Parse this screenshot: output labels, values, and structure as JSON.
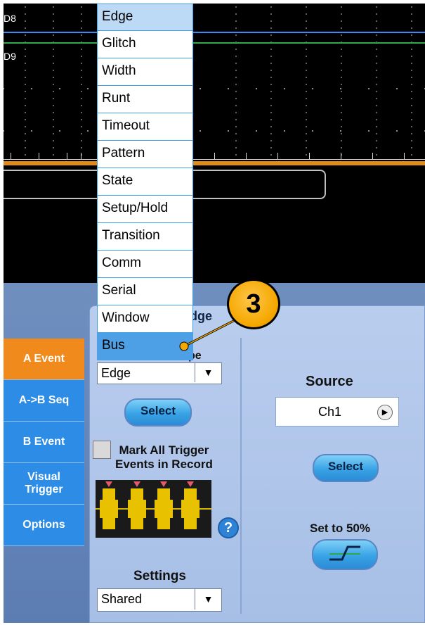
{
  "scope": {
    "channels": [
      "D8",
      "D9"
    ],
    "colors": {
      "d8_line": "#3a8cf0",
      "d9_line": "#2ea84a",
      "orange_line": "#e08a1a"
    }
  },
  "trigger_menu": {
    "items": [
      "Edge",
      "Glitch",
      "Width",
      "Runt",
      "Timeout",
      "Pattern",
      "State",
      "Setup/Hold",
      "Transition",
      "Comm",
      "Serial",
      "Window",
      "Bus"
    ],
    "selected": "Edge",
    "highlighted": "Bus"
  },
  "tabs": [
    "A Event",
    "A->B Seq",
    "B Event",
    "Visual\nTrigger",
    "Options"
  ],
  "panel": {
    "title_fragment": "dge",
    "type_fragment": "pe",
    "type_value": "Edge",
    "type_select_label": "Select",
    "mark_all_label": "Mark All Trigger\nEvents in Record",
    "help_icon": "question-mark",
    "settings_label": "Settings",
    "settings_value": "Shared",
    "source_label": "Source",
    "source_value": "Ch1",
    "source_select_label": "Select",
    "set50_label": "Set to 50%"
  },
  "callout_number": "3",
  "dropdown_arrow": "▼",
  "source_arrow": "▶"
}
